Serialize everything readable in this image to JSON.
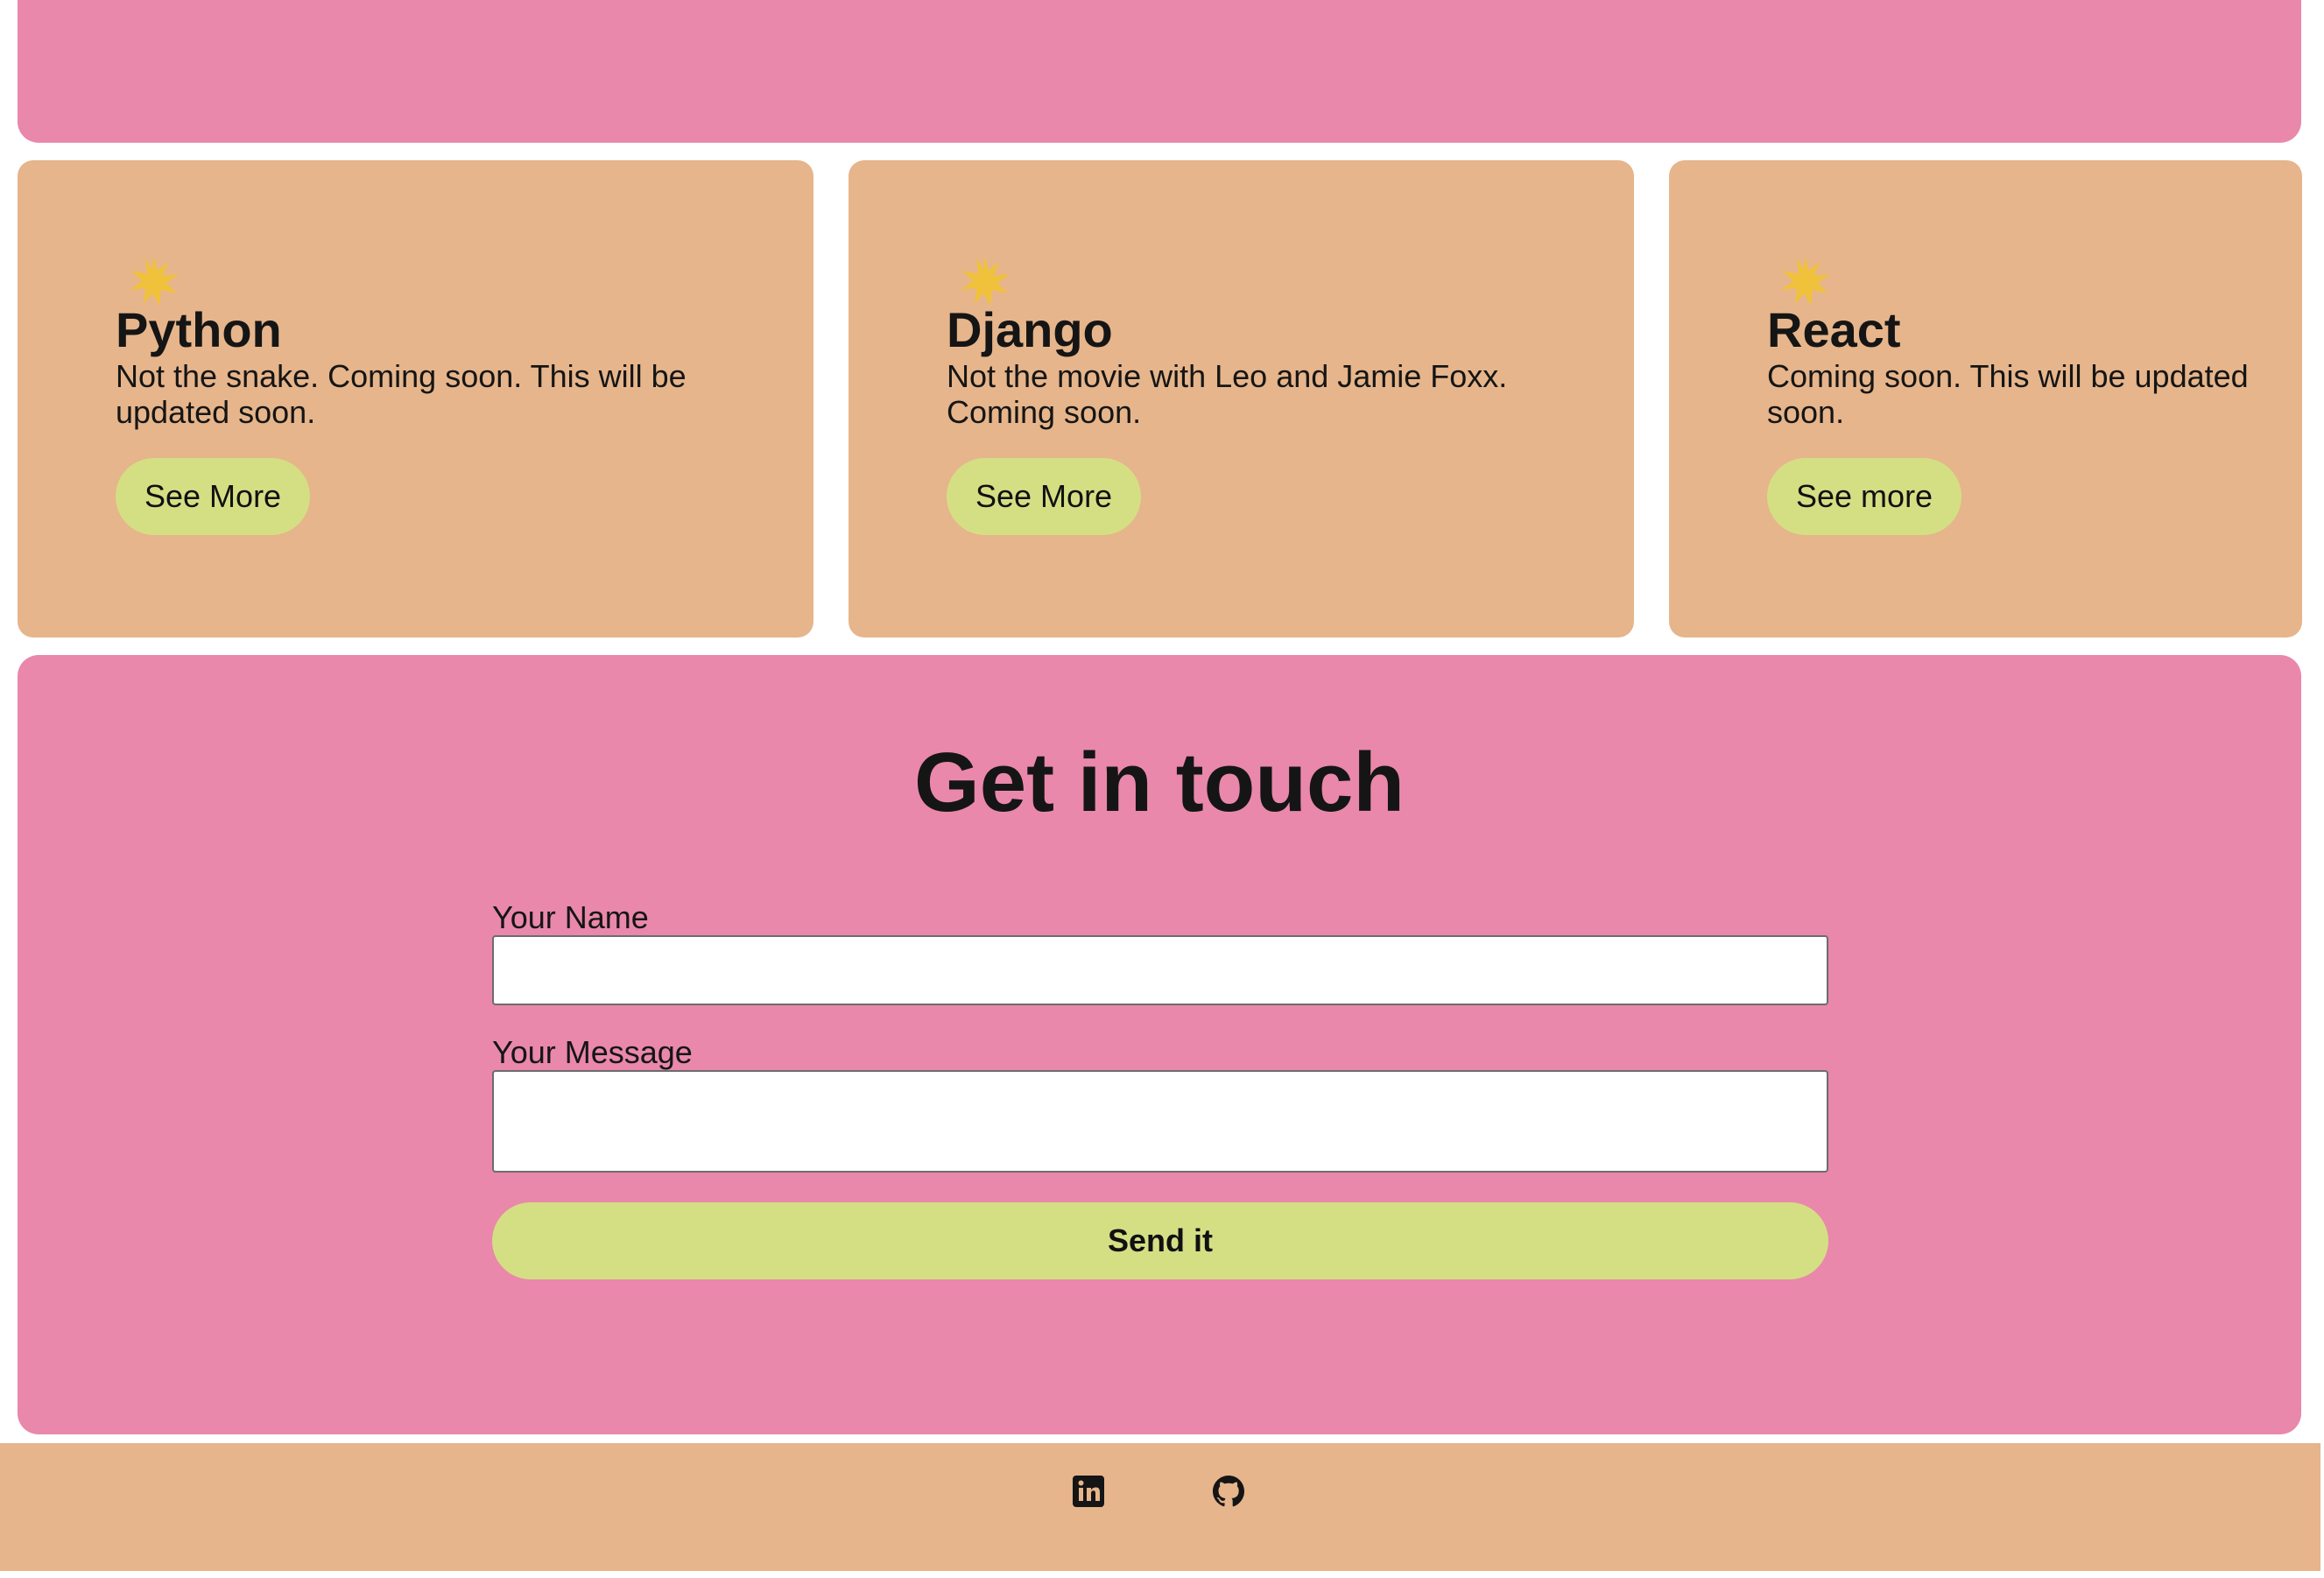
{
  "colors": {
    "pink": "#E988AA",
    "tan": "#E6B58B",
    "green": "#D4DF84",
    "star": "#F0C23C",
    "text": "#151515"
  },
  "skills": [
    {
      "title": "Python",
      "description": "Not the snake. Coming soon. This will be updated soon.",
      "button": "See More",
      "icon": "sparkle-icon"
    },
    {
      "title": "Django",
      "description": "Not the movie with Leo and Jamie Foxx. Coming soon.",
      "button": "See More",
      "icon": "sparkle-icon"
    },
    {
      "title": "React",
      "description": "Coming soon. This will be updated soon.",
      "button": "See more",
      "icon": "sparkle-icon"
    }
  ],
  "contact": {
    "heading": "Get in touch",
    "name_label": "Your Name",
    "name_value": "",
    "message_label": "Your Message",
    "message_value": "",
    "submit_label": "Send it"
  },
  "footer": {
    "icons": [
      "linkedin-icon",
      "github-icon"
    ]
  }
}
